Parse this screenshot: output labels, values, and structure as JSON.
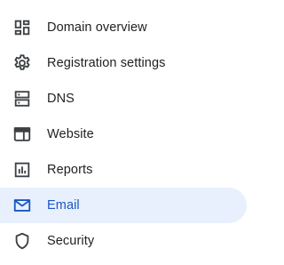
{
  "nav": {
    "items": [
      {
        "label": "Domain overview",
        "icon": "dashboard-icon",
        "active": false
      },
      {
        "label": "Registration settings",
        "icon": "settings-icon",
        "active": false
      },
      {
        "label": "DNS",
        "icon": "dns-icon",
        "active": false
      },
      {
        "label": "Website",
        "icon": "web-icon",
        "active": false
      },
      {
        "label": "Reports",
        "icon": "reports-icon",
        "active": false
      },
      {
        "label": "Email",
        "icon": "mail-icon",
        "active": true
      },
      {
        "label": "Security",
        "icon": "shield-icon",
        "active": false
      }
    ]
  },
  "colors": {
    "text": "#202124",
    "icon": "#3c4043",
    "active_text": "#1a56c4",
    "active_background": "#e8f0fe"
  }
}
